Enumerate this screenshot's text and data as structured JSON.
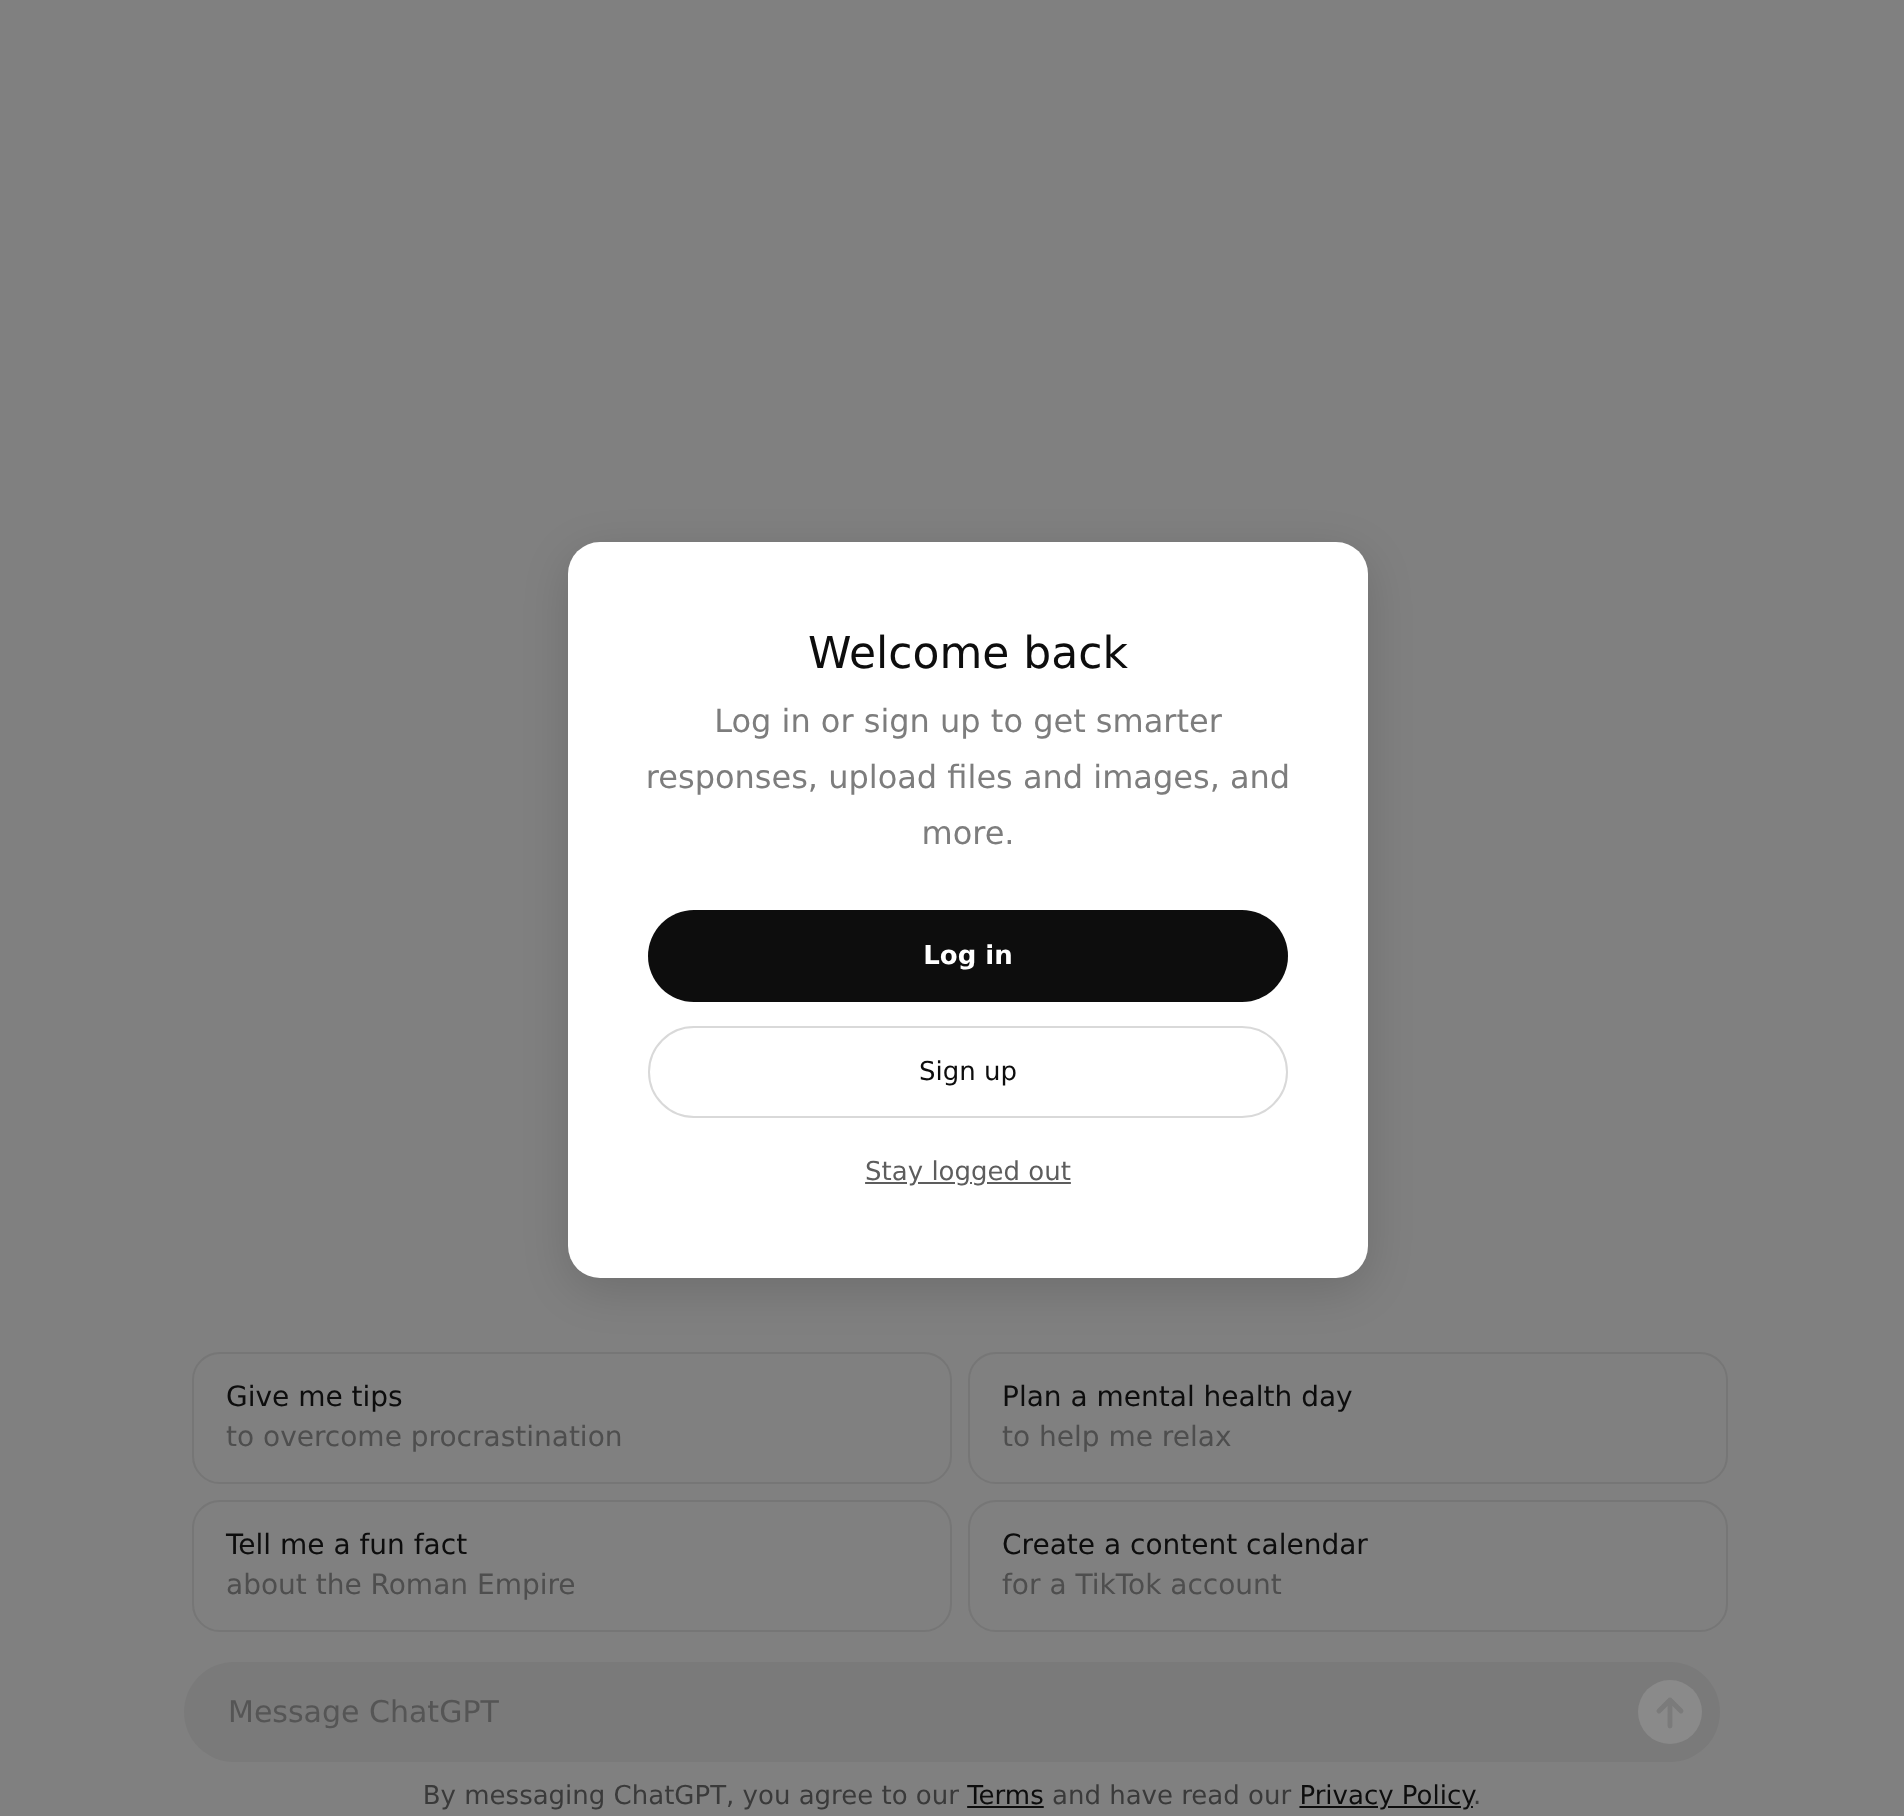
{
  "suggestions": [
    {
      "title": "Give me tips",
      "subtitle": "to overcome procrastination"
    },
    {
      "title": "Plan a mental health day",
      "subtitle": "to help me relax"
    },
    {
      "title": "Tell me a fun fact",
      "subtitle": "about the Roman Empire"
    },
    {
      "title": "Create a content calendar",
      "subtitle": "for a TikTok account"
    }
  ],
  "composer": {
    "placeholder": "Message ChatGPT"
  },
  "disclaimer": [
    {
      "kind": "text",
      "text": "By messaging ChatGPT, you agree to our "
    },
    {
      "kind": "link",
      "text": "Terms"
    },
    {
      "kind": "text",
      "text": " and have read our "
    },
    {
      "kind": "link",
      "text": "Privacy Policy"
    },
    {
      "kind": "text",
      "text": "."
    }
  ],
  "dialog": {
    "title": "Welcome back",
    "message": "Log in or sign up to get smarter responses, upload files and images, and more.",
    "buttons": [
      {
        "label": "Log in",
        "kind": "primary"
      },
      {
        "label": "Sign up",
        "kind": "secondary"
      }
    ],
    "link": "Stay logged out"
  }
}
